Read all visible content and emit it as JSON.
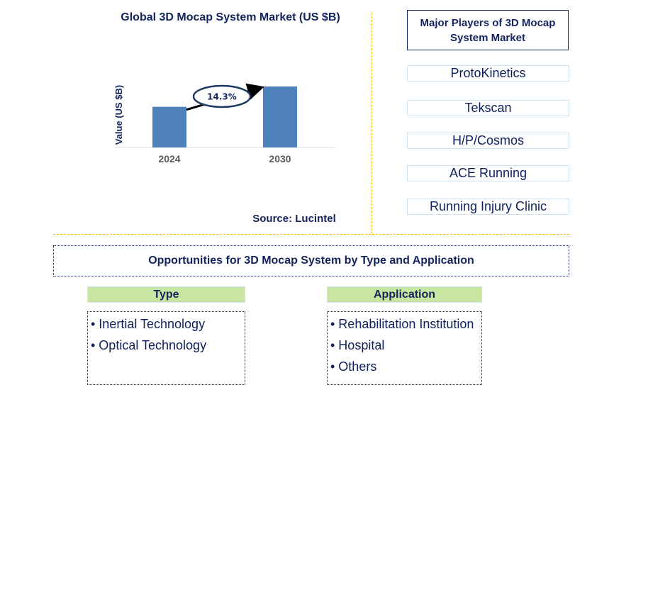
{
  "chart_data": {
    "type": "bar",
    "title": "Global 3D Mocap System Market (US $B)",
    "xlabel": "",
    "ylabel": "Value (US $B)",
    "categories": [
      "2024",
      "2030"
    ],
    "values": [
      1.0,
      1.5
    ],
    "value_units": "relative (no axis values shown)",
    "annotation": {
      "label": "14.3%",
      "meaning": "CAGR 2024-2030",
      "from": "2024",
      "to": "2030"
    },
    "grid": false,
    "legend": "none",
    "colors": {
      "bar": "#4f81bd"
    }
  },
  "source": "Source: Lucintel",
  "players": {
    "title": "Major Players of 3D Mocap System Market",
    "items": [
      "ProtoKinetics",
      "Tekscan",
      "H/P/Cosmos",
      "ACE Running",
      "Running Injury Clinic"
    ]
  },
  "opportunities": {
    "title": "Opportunities for 3D Mocap System by Type and Application",
    "type": {
      "header": "Type",
      "items": [
        "• Inertial Technology",
        "• Optical Technology"
      ]
    },
    "application": {
      "header": "Application",
      "items": [
        "• Rehabilitation Institution",
        "• Hospital",
        "• Others"
      ]
    }
  },
  "colors": {
    "text": "#13245e",
    "accent": "#f5b800",
    "header_green": "#c9e5a2",
    "bar": "#4f81bd"
  }
}
